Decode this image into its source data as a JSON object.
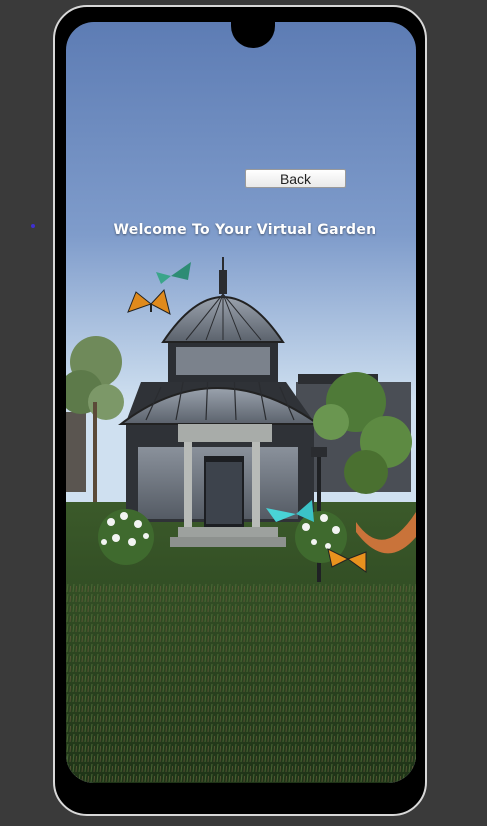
{
  "app": {
    "welcome_text": "Welcome To Your Virtual Garden"
  },
  "controls": {
    "back_label": "Back"
  },
  "scene": {
    "description_icons": [
      "greenhouse-icon",
      "butterfly-icon",
      "flower-bush-icon",
      "hammock-icon",
      "lamp-post-icon"
    ],
    "colors": {
      "sky_top": "#5d7cb4",
      "sky_bottom": "#cfe0f0",
      "grass": "#2e4a1f",
      "frame": "#000000"
    }
  }
}
